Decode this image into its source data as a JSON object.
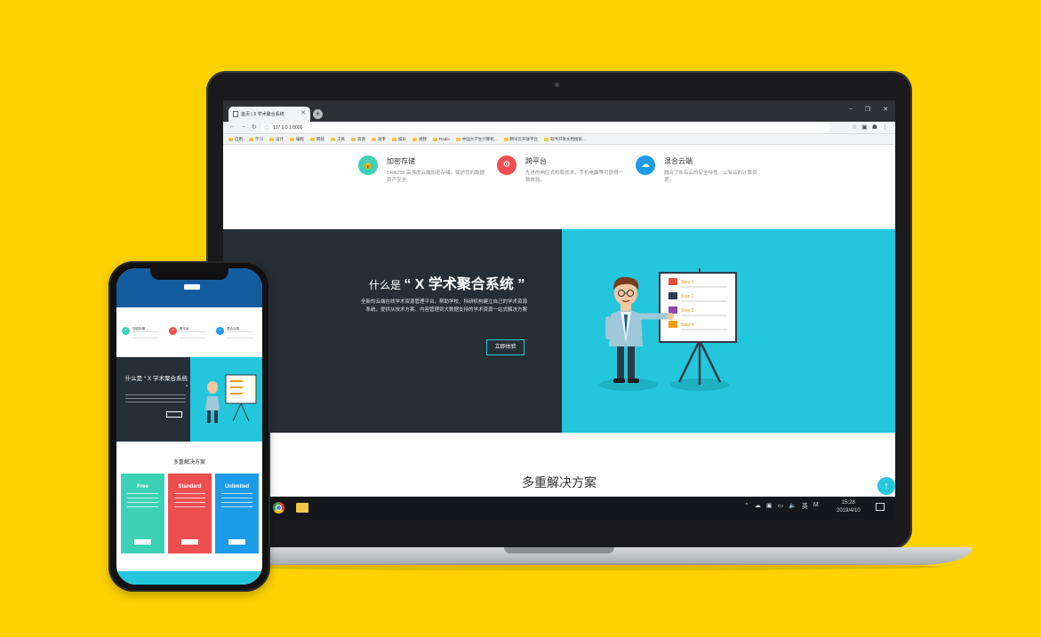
{
  "browser": {
    "tab_title": "首页 | X 学术聚合系统",
    "url": "127.0.0.1:8000",
    "bookmarks": [
      "应用",
      "学习",
      "设计",
      "编程",
      "网站",
      "工具",
      "资源",
      "效率",
      "娱乐",
      "视频",
      "Radio",
      "中国大学生计算机...",
      "腾讯云开放平台",
      "软件开发文档搜索..."
    ]
  },
  "features": [
    {
      "title": "加密存储",
      "desc": "SHA256 高强度云端加密存储，保护您的数据资产安全。",
      "color": "#3dd1b5",
      "icon": "lock-icon"
    },
    {
      "title": "跨平台",
      "desc": "先进的响应式布局技术，手机电脑等可获得一致体验。",
      "color": "#ed4f51",
      "icon": "devices-icon"
    },
    {
      "title": "混合云端",
      "desc": "融合了私有云的安全特性，公有云的计算资源。",
      "color": "#1b9be8",
      "icon": "cloud-icon"
    }
  ],
  "what": {
    "title_prefix": "什么是",
    "title_main": "“ X 学术聚合系统 ”",
    "desc": "全新的云端在线学术资源管理平台，帮助学校、科研机构建立自己的学术资源系统，提供从技术方案、内容管理到大数据支持的学术资源一站式解决方案",
    "button": "立即体验",
    "board_steps": [
      "Step 1",
      "Step 2",
      "Step 3",
      "Step 4"
    ]
  },
  "solutions": {
    "title": "多重解决方案"
  },
  "taskbar": {
    "time": "15:28",
    "date": "2019/4/10",
    "ime": "英",
    "ime2": "M"
  },
  "phone": {
    "features": [
      "加密存储",
      "跨平台",
      "混合云端"
    ],
    "what_title": "什么是 “ X 学术聚合系统 ”",
    "sol_title": "多重解决方案",
    "plans": [
      {
        "name": "Free",
        "color": "#3dd1b5"
      },
      {
        "name": "Standard",
        "color": "#ed4f51"
      },
      {
        "name": "Unlimited",
        "color": "#1b9be8"
      }
    ]
  }
}
